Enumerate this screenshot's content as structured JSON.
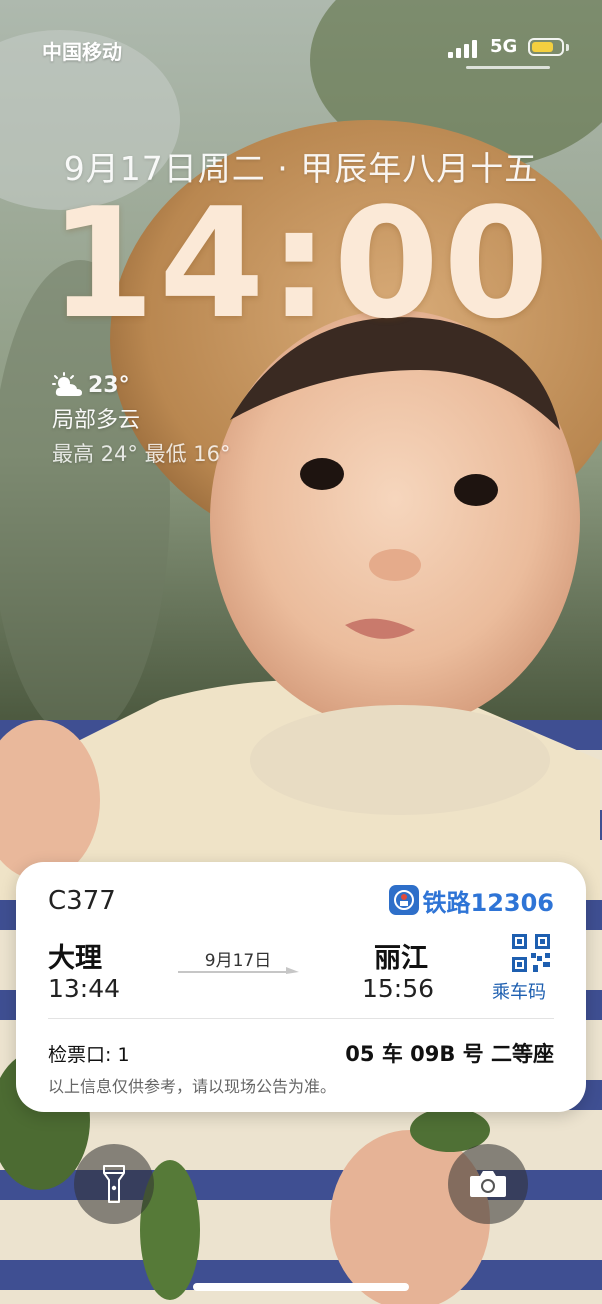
{
  "status_bar": {
    "carrier": "中国移动",
    "network": "5G",
    "battery_level": 0.75,
    "battery_color": "#f4d03f"
  },
  "lock_screen": {
    "date": "9月17日周二 · 甲辰年八月十五",
    "time": "14:00"
  },
  "weather": {
    "icon": "partly-cloudy-icon",
    "temperature": "23°",
    "condition": "局部多云",
    "range": "最高 24° 最低 16°"
  },
  "ticket": {
    "train_number": "C377",
    "brand": "铁路12306",
    "brand_color": "#2e74d6",
    "from_city": "大理",
    "from_time": "13:44",
    "date": "9月17日",
    "to_city": "丽江",
    "to_time": "15:56",
    "qr_label": "乘车码",
    "gate": "检票口: 1",
    "seat": "05 车 09B 号 二等座",
    "note": "以上信息仅供参考，请以现场公告为准。"
  },
  "controls": {
    "flashlight": "flashlight-icon",
    "camera": "camera-icon"
  }
}
